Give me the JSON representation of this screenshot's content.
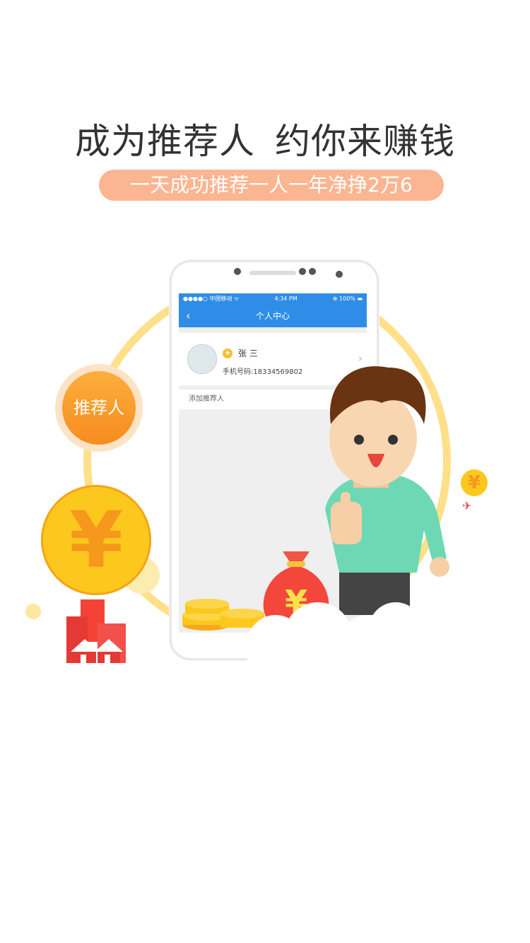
{
  "header": {
    "headline_part1": "成为推荐人",
    "headline_part2": "约你来赚钱",
    "subtitle": "一天成功推荐一人一年净挣2万6"
  },
  "phone_screen": {
    "statusbar": {
      "carrier": "●●●●○ 中国移动 ᯤ",
      "time": "4:34 PM",
      "battery": "⊕ 100% ▬"
    },
    "navbar": {
      "back_icon": "chevron-left-icon",
      "title": "个人中心"
    },
    "profile": {
      "name": "张  三",
      "phone": "手机号码:18334569802"
    },
    "add_referrer": "添加推荐人"
  },
  "decorations": {
    "tag_label": "推荐人",
    "coin_symbol": "¥",
    "bag_symbol": "¥"
  },
  "colors": {
    "accent_orange": "#f68c1f",
    "pill": "#fbb591",
    "navbar_blue": "#2f8de8",
    "coin_yellow": "#fcc81d",
    "ring_yellow": "#ffe08a"
  }
}
